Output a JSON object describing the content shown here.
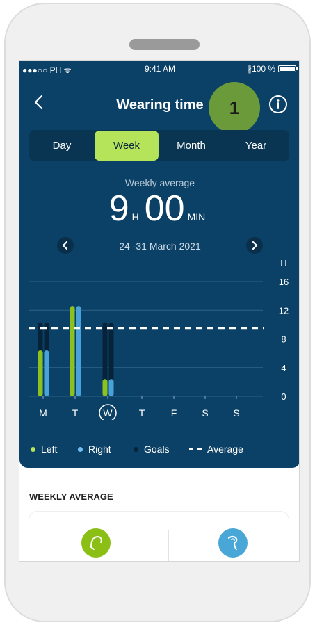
{
  "status_bar": {
    "carrier": "●●●○○ PH ᯤ",
    "time": "9:41 AM",
    "battery": "∦100 %"
  },
  "header": {
    "title": "Wearing time",
    "callout": "1"
  },
  "tabs": [
    {
      "label": "Day",
      "active": false
    },
    {
      "label": "Week",
      "active": true
    },
    {
      "label": "Month",
      "active": false
    },
    {
      "label": "Year",
      "active": false
    }
  ],
  "summary": {
    "label": "Weekly average",
    "hours": "9",
    "hours_unit": "H",
    "minutes": "00",
    "minutes_unit": "MIN",
    "date_range": "24 -31 March 2021"
  },
  "legend": {
    "left": "Left",
    "right": "Right",
    "goals": "Goals",
    "average": "Average"
  },
  "section": {
    "title": "WEEKLY AVERAGE"
  },
  "colors": {
    "panel": "#0b4166",
    "left": "#8cc21f",
    "right": "#4aa3d8",
    "goal": "#06233a",
    "active_tab": "#b5e35a"
  },
  "chart_data": {
    "type": "bar",
    "categories": [
      "M",
      "T",
      "W",
      "T",
      "F",
      "S",
      "S"
    ],
    "selected_index": 2,
    "ylabel": "H",
    "ylim": [
      0,
      16
    ],
    "yticks": [
      0,
      4,
      8,
      12,
      16
    ],
    "average": 9.5,
    "series": [
      {
        "name": "Left",
        "values": [
          6.4,
          12.6,
          2.4,
          null,
          null,
          null,
          null
        ]
      },
      {
        "name": "Right",
        "values": [
          6.4,
          12.6,
          2.4,
          null,
          null,
          null,
          null
        ]
      },
      {
        "name": "Goals",
        "values": [
          10.3,
          10.3,
          10.3,
          null,
          null,
          null,
          null
        ]
      }
    ]
  }
}
